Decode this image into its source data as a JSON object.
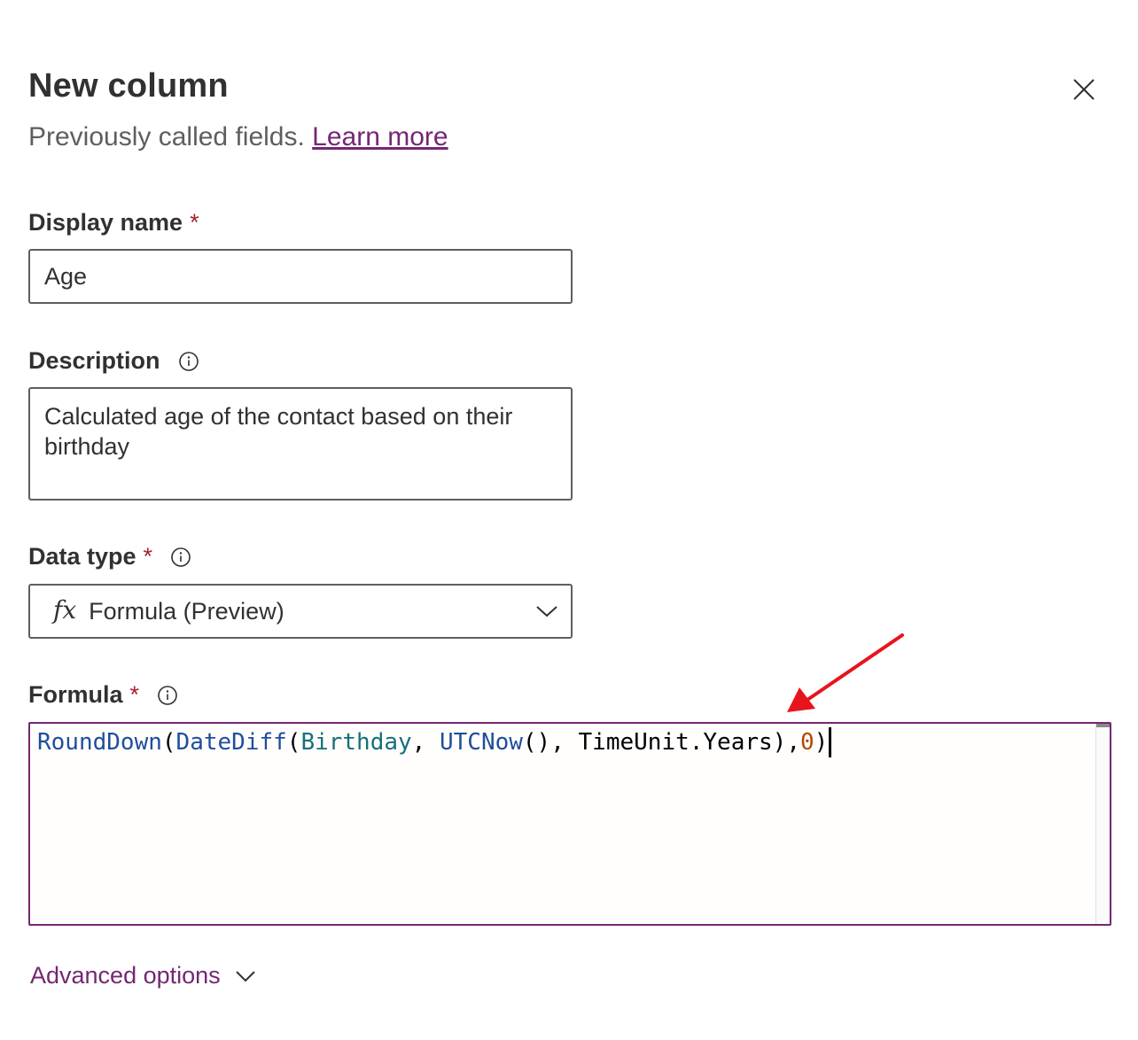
{
  "panel": {
    "title": "New column",
    "subtitle_text": "Previously called fields. ",
    "subtitle_link": "Learn more"
  },
  "display_name": {
    "label": "Display name",
    "required_mark": "*",
    "value": "Age"
  },
  "description": {
    "label": "Description",
    "value": "Calculated age of the contact based on their birthday"
  },
  "data_type": {
    "label": "Data type",
    "required_mark": "*",
    "icon_text": "fx",
    "selected": "Formula (Preview)"
  },
  "formula": {
    "label": "Formula",
    "required_mark": "*",
    "tokens": {
      "t1": "RoundDown",
      "t2": "(",
      "t3": "DateDiff",
      "t4": "(",
      "t5": "Birthday",
      "t6": ", ",
      "t7": "UTCNow",
      "t8": "(), TimeUnit.Years),",
      "t9": "0",
      "t10": ")"
    }
  },
  "advanced_options": {
    "label": "Advanced options"
  },
  "colors": {
    "accent": "#742774",
    "required": "#a4262c",
    "annotation_arrow": "#e8141b"
  }
}
